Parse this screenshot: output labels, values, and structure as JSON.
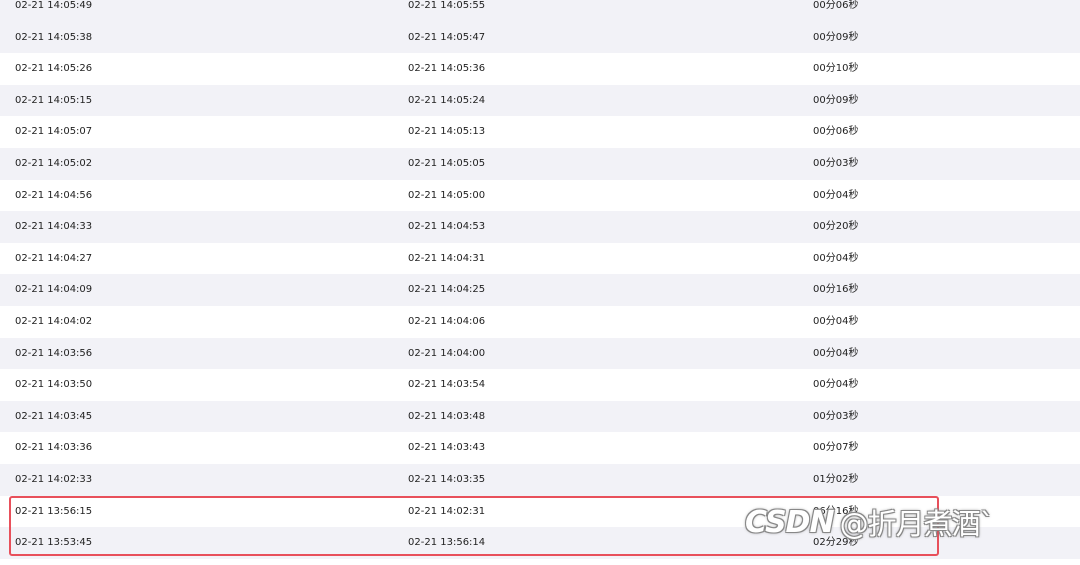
{
  "rows": [
    {
      "start": "02-21 14:05:49",
      "end": "02-21 14:05:55",
      "duration": "00分06秒"
    },
    {
      "start": "02-21 14:05:38",
      "end": "02-21 14:05:47",
      "duration": "00分09秒"
    },
    {
      "start": "02-21 14:05:26",
      "end": "02-21 14:05:36",
      "duration": "00分10秒"
    },
    {
      "start": "02-21 14:05:15",
      "end": "02-21 14:05:24",
      "duration": "00分09秒"
    },
    {
      "start": "02-21 14:05:07",
      "end": "02-21 14:05:13",
      "duration": "00分06秒"
    },
    {
      "start": "02-21 14:05:02",
      "end": "02-21 14:05:05",
      "duration": "00分03秒"
    },
    {
      "start": "02-21 14:04:56",
      "end": "02-21 14:05:00",
      "duration": "00分04秒"
    },
    {
      "start": "02-21 14:04:33",
      "end": "02-21 14:04:53",
      "duration": "00分20秒"
    },
    {
      "start": "02-21 14:04:27",
      "end": "02-21 14:04:31",
      "duration": "00分04秒"
    },
    {
      "start": "02-21 14:04:09",
      "end": "02-21 14:04:25",
      "duration": "00分16秒"
    },
    {
      "start": "02-21 14:04:02",
      "end": "02-21 14:04:06",
      "duration": "00分04秒"
    },
    {
      "start": "02-21 14:03:56",
      "end": "02-21 14:04:00",
      "duration": "00分04秒"
    },
    {
      "start": "02-21 14:03:50",
      "end": "02-21 14:03:54",
      "duration": "00分04秒"
    },
    {
      "start": "02-21 14:03:45",
      "end": "02-21 14:03:48",
      "duration": "00分03秒"
    },
    {
      "start": "02-21 14:03:36",
      "end": "02-21 14:03:43",
      "duration": "00分07秒"
    },
    {
      "start": "02-21 14:02:33",
      "end": "02-21 14:03:35",
      "duration": "01分02秒"
    },
    {
      "start": "02-21 13:56:15",
      "end": "02-21 14:02:31",
      "duration": "06分16秒"
    },
    {
      "start": "02-21 13:53:45",
      "end": "02-21 13:56:14",
      "duration": "02分29秒"
    }
  ],
  "watermark": {
    "logo": "CSDN",
    "handle": "@折月煮酒`"
  },
  "colors": {
    "stripe": "#f2f2f7",
    "highlight_border": "#e8505b"
  }
}
